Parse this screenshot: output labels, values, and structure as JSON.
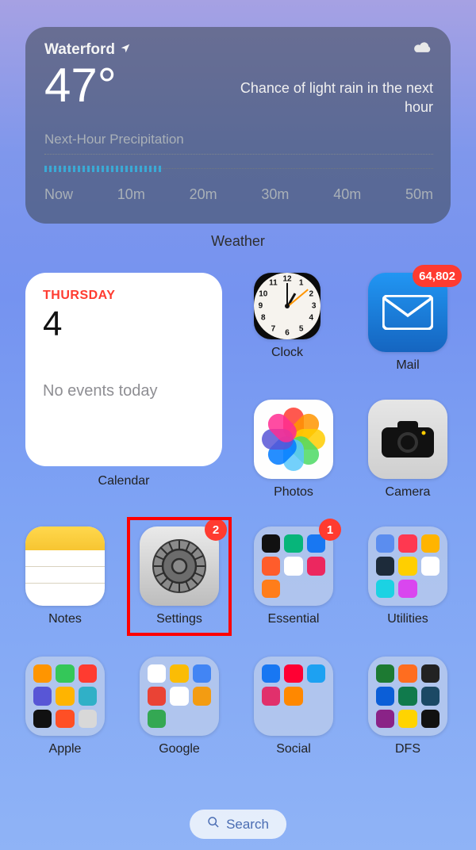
{
  "weather": {
    "location": "Waterford",
    "temperature": "47°",
    "forecast_line": "Chance of light rain in the next hour",
    "precip_label": "Next-Hour Precipitation",
    "timeline": [
      "Now",
      "10m",
      "20m",
      "30m",
      "40m",
      "50m"
    ],
    "widget_label": "Weather"
  },
  "calendar": {
    "day_name": "THURSDAY",
    "day_number": "4",
    "events_text": "No events today",
    "label": "Calendar"
  },
  "apps": {
    "clock": {
      "label": "Clock"
    },
    "mail": {
      "label": "Mail",
      "badge": "64,802"
    },
    "photos": {
      "label": "Photos"
    },
    "camera": {
      "label": "Camera"
    },
    "notes": {
      "label": "Notes"
    },
    "settings": {
      "label": "Settings",
      "badge": "2"
    },
    "essential": {
      "label": "Essential",
      "badge": "1"
    },
    "utilities": {
      "label": "Utilities"
    },
    "apple": {
      "label": "Apple"
    },
    "google": {
      "label": "Google"
    },
    "social": {
      "label": "Social"
    },
    "dfs": {
      "label": "DFS"
    }
  },
  "search": {
    "label": "Search"
  },
  "clock_numbers": [
    "12",
    "1",
    "2",
    "3",
    "4",
    "5",
    "6",
    "7",
    "8",
    "9",
    "10",
    "11"
  ]
}
